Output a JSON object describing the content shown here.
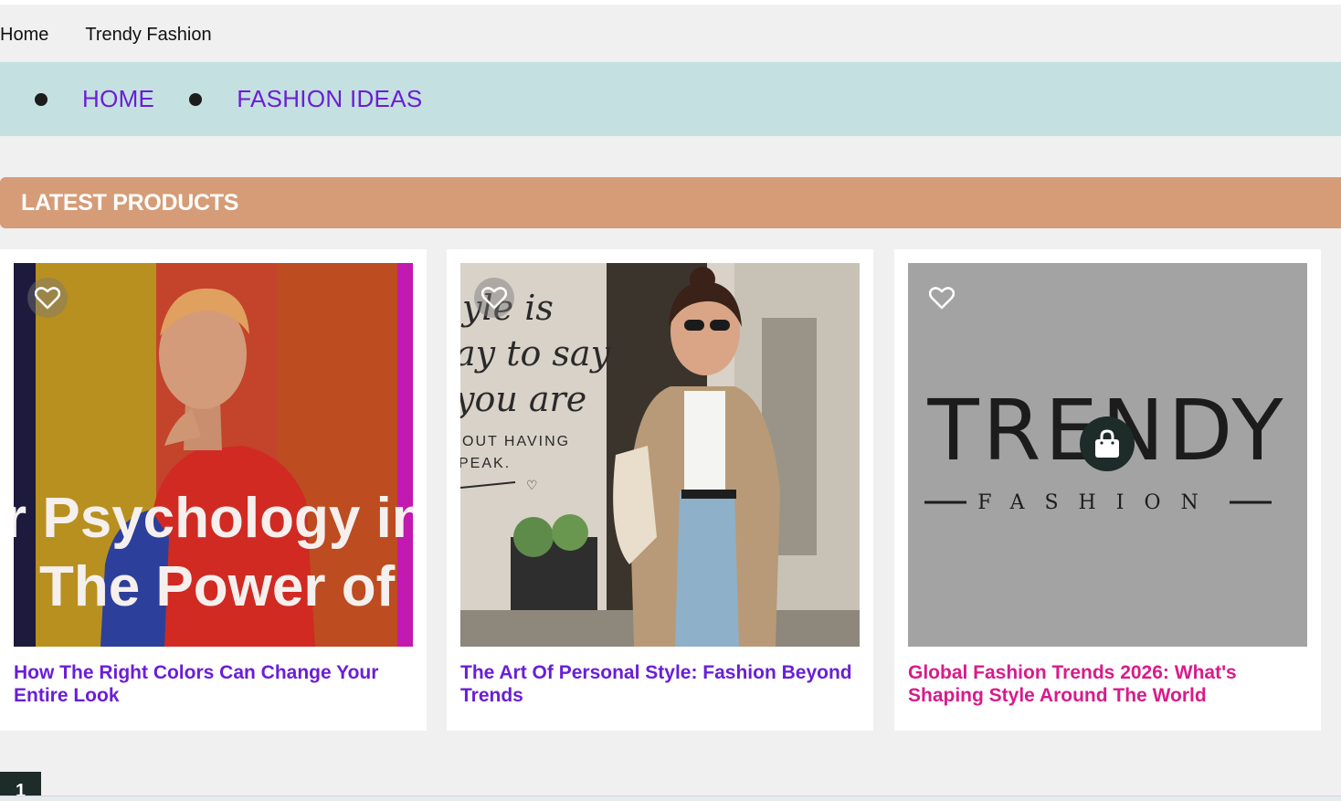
{
  "breadcrumb": {
    "home": "Home",
    "current": "Trendy Fashion"
  },
  "nav": {
    "items": [
      {
        "label": "HOME"
      },
      {
        "label": "FASHION IDEAS"
      }
    ]
  },
  "section": {
    "title": "LATEST PRODUCTS"
  },
  "products": [
    {
      "title": "How The Right Colors Can Change Your Entire Look",
      "image_text_line1": "r Psychology in Fa",
      "image_text_line2": "The Power of Hue"
    },
    {
      "title": "The Art Of Personal Style: Fashion Beyond Trends",
      "image_text_line1": "yle is",
      "image_text_line2": "ay to say",
      "image_text_line3": "you are",
      "image_text_line4": "OUT HAVING",
      "image_text_line5": "PEAK."
    },
    {
      "title": "Global Fashion Trends 2026: What's Shaping Style Around The World",
      "logo_main": "TRENDY",
      "logo_sub": "FASHION"
    }
  ],
  "pagination": {
    "current": "1"
  },
  "icons": {
    "wishlist": "heart-outline-icon",
    "cart": "shopping-bag-icon"
  },
  "colors": {
    "link": "#6a1ed6",
    "link_hover": "#d81b8a",
    "nav_bg": "#c5e0e0",
    "header_bg": "#d59c77",
    "dark": "#1d2b29"
  }
}
